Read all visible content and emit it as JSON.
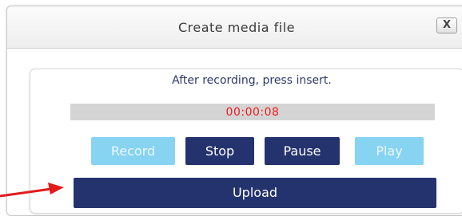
{
  "dialog": {
    "title": "Create media file",
    "close_label": "X"
  },
  "recorder": {
    "instruction": "After recording, press insert.",
    "timer": "00:00:08",
    "buttons": {
      "record": "Record",
      "stop": "Stop",
      "pause": "Pause",
      "play": "Play",
      "upload": "Upload"
    }
  },
  "annotation": {
    "arrow_icon": "red-arrow-icon",
    "color": "#e11b1b"
  },
  "colors": {
    "primary_button": "#24336e",
    "disabled_button": "#86d3f2",
    "timer_text": "#ee1c1c"
  }
}
